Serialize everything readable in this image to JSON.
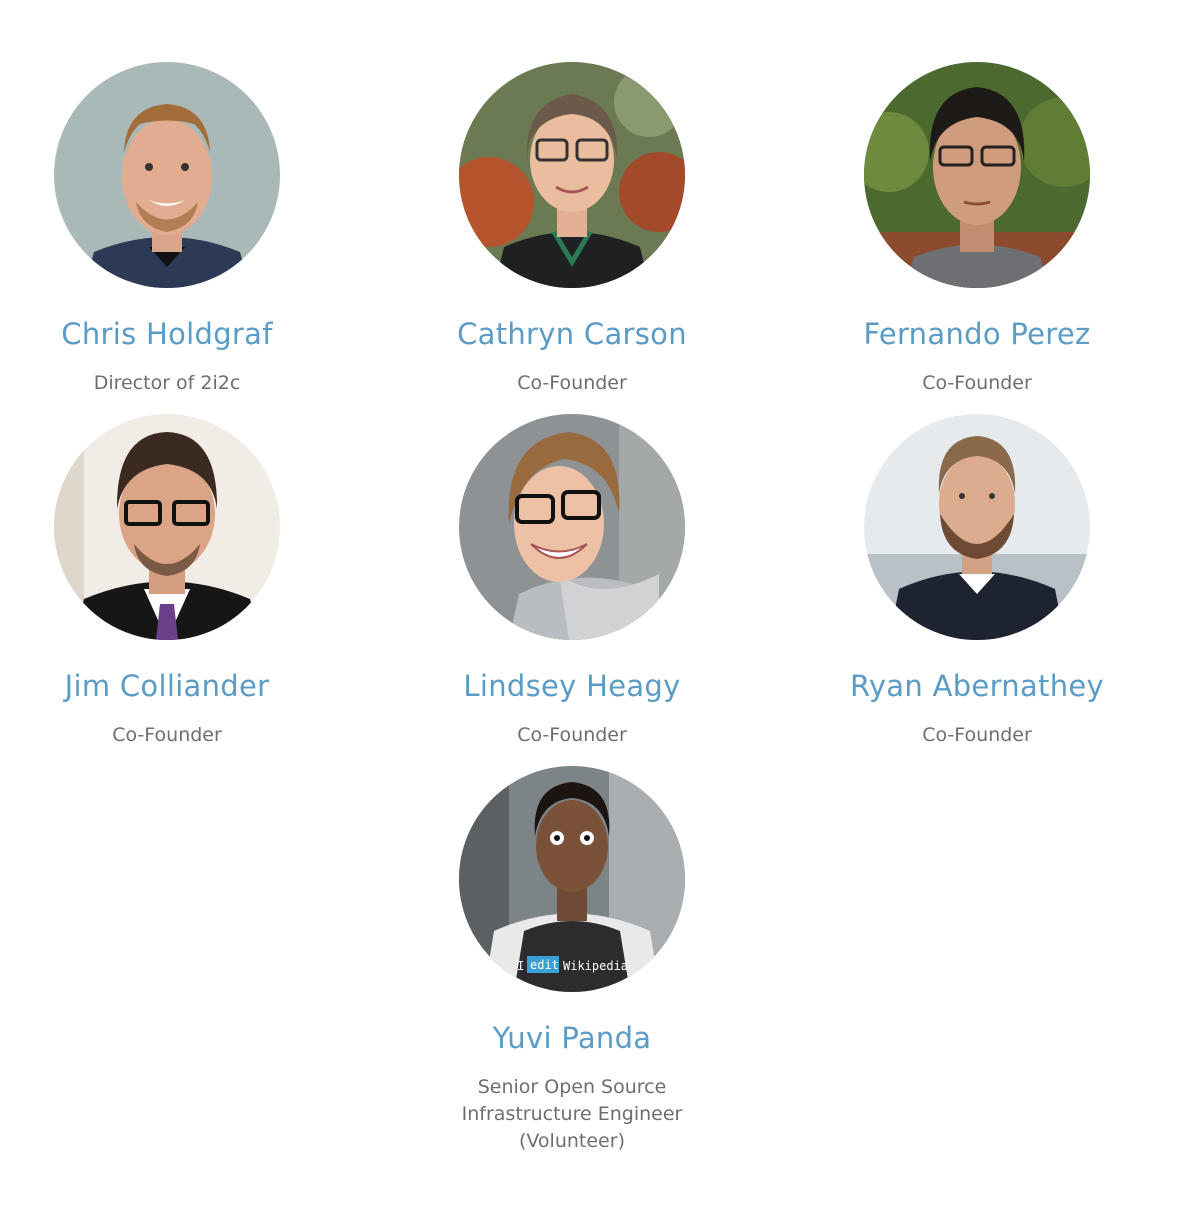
{
  "team": [
    {
      "name": "Chris Holdgraf",
      "role": "Director of 2i2c"
    },
    {
      "name": "Cathryn Carson",
      "role": "Co-Founder"
    },
    {
      "name": "Fernando Perez",
      "role": "Co-Founder"
    },
    {
      "name": "Jim Colliander",
      "role": "Co-Founder"
    },
    {
      "name": "Lindsey Heagy",
      "role": "Co-Founder"
    },
    {
      "name": "Ryan Abernathey",
      "role": "Co-Founder"
    },
    {
      "name": "Yuvi Panda",
      "role": "Senior Open Source Infrastructure Engineer (Volunteer)",
      "shirt_text": [
        "I",
        "edit",
        "Wikipedia"
      ]
    }
  ]
}
